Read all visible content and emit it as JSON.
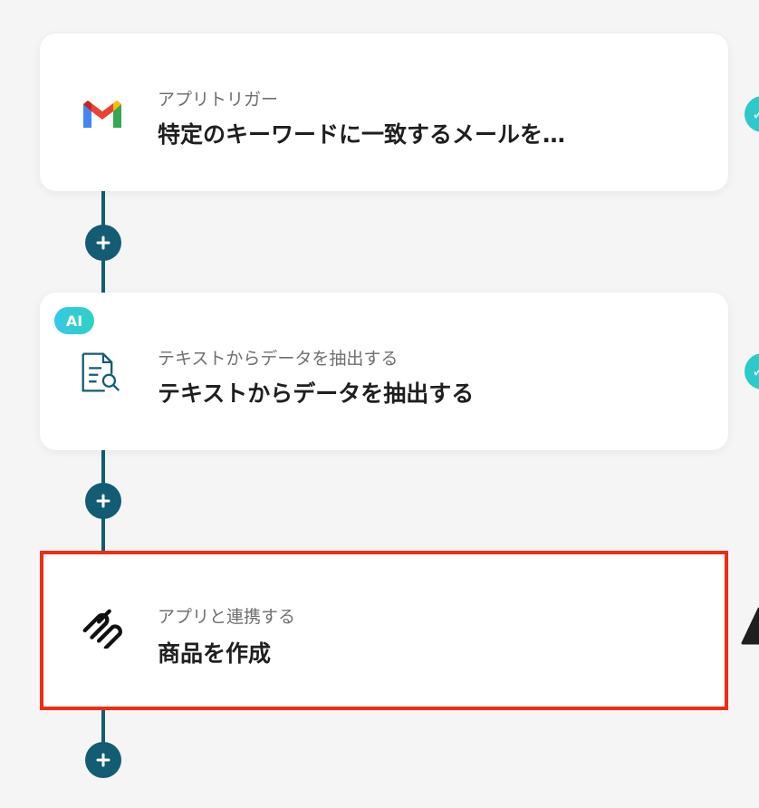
{
  "flow": {
    "steps": [
      {
        "icon": "gmail-icon",
        "subtitle": "アプリトリガー",
        "title": "特定のキーワードに一致するメールを…"
      },
      {
        "icon": "text-extract-icon",
        "badge": "AI",
        "subtitle": "テキストからデータを抽出する",
        "title": "テキストからデータを抽出する"
      },
      {
        "icon": "squarespace-icon",
        "subtitle": "アプリと連携する",
        "title": "商品を作成"
      }
    ]
  },
  "colors": {
    "connector": "#135c74",
    "selected_border": "#ee2d13",
    "ai_badge": "#38c7e6",
    "check": "#2ec9c9"
  }
}
